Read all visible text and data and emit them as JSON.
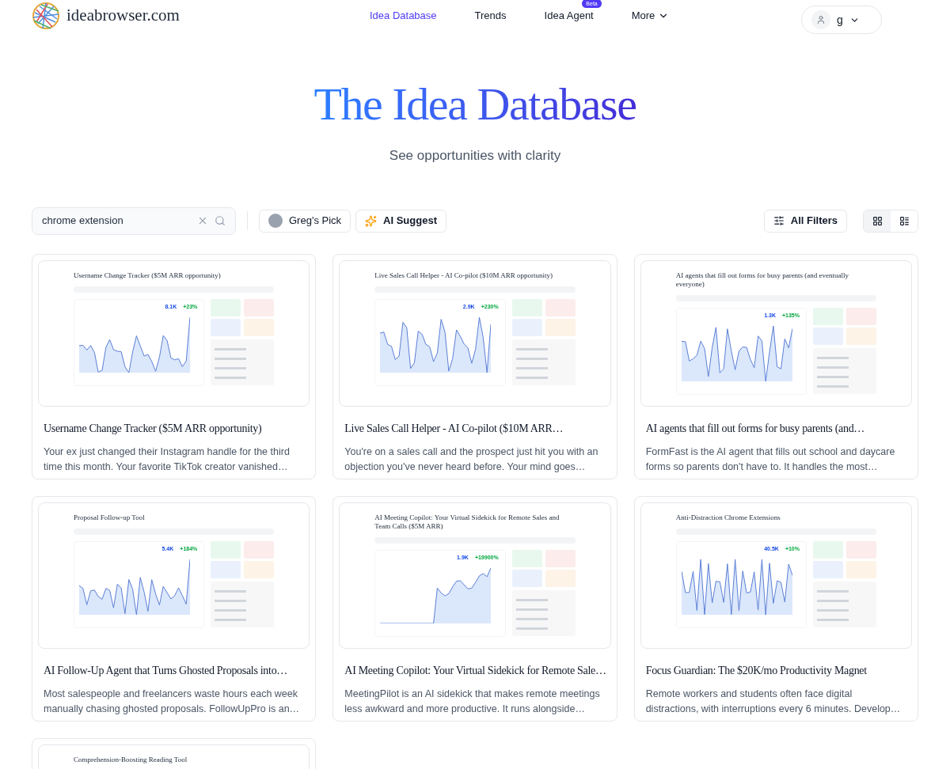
{
  "brand": {
    "name": "ideabrowser.com"
  },
  "nav": [
    {
      "label": "Idea Database",
      "selected": true
    },
    {
      "label": "Trends",
      "selected": false
    },
    {
      "label": "Idea Agent",
      "selected": false,
      "badge": "Beta"
    },
    {
      "label": "More",
      "selected": false,
      "dropdown": true
    }
  ],
  "account": {
    "initial": "g"
  },
  "hero": {
    "title": "The Idea Database",
    "subtitle": "See opportunities with clarity"
  },
  "search": {
    "value": "chrome extension"
  },
  "quick_filters": [
    {
      "kind": "avatar",
      "label": "Greg's Pick"
    },
    {
      "kind": "sparkle",
      "label": "AI Suggest"
    }
  ],
  "filters_button": "All Filters",
  "views": [
    {
      "kind": "grid",
      "selected": true
    },
    {
      "kind": "list",
      "selected": false
    }
  ],
  "cards": [
    {
      "preview_title": "Username Change Tracker ($5M ARR opportunity)",
      "volume": "8.1K",
      "growth": "+23%",
      "title": "Username Change Tracker ($5M ARR opportunity)",
      "description": "Your ex just changed their Instagram handle for the third time this month. Your favorite TikTok creator vanished…"
    },
    {
      "preview_title": "Live Sales Call Helper - AI Co-pilot ($10M ARR opportunity)",
      "volume": "2.9K",
      "growth": "+230%",
      "title": "Live Sales Call Helper - AI Co-pilot ($10M ARR…",
      "description": "You're on a sales call and the prospect just hit you with an objection you've never heard before. Your mind goes…"
    },
    {
      "preview_title": "AI agents that fill out forms for busy parents (and eventually everyone)",
      "volume": "1.3K",
      "growth": "+135%",
      "title": "AI agents that fill out forms for busy parents (and…",
      "description": "FormFast is the AI agent that fills out school and daycare forms so parents don't have to. It handles the most…"
    },
    {
      "preview_title": "Proposal Follow-up Tool",
      "volume": "5.4K",
      "growth": "+184%",
      "title": "AI Follow-Up Agent that Turns Ghosted Proposals into…",
      "description": "Most salespeople and freelancers waste hours each week manually chasing ghosted proposals. FollowUpPro is an…"
    },
    {
      "preview_title": "AI Meeting Copilot: Your Virtual Sidekick for Remote Sales and Team Calls ($5M ARR)",
      "volume": "1.9K",
      "growth": "+19900%",
      "title": "AI Meeting Copilot: Your Virtual Sidekick for Remote Sale…",
      "description": "MeetingPilot is an AI sidekick that makes remote meetings less awkward and more productive. It runs alongside…"
    },
    {
      "preview_title": "Anti-Distraction Chrome Extensions",
      "volume": "40.5K",
      "growth": "+10%",
      "title": "Focus Guardian: The $20K/mo Productivity Magnet",
      "description": "Remote workers and students often face digital distractions, with interruptions every 6 minutes. Develop…"
    },
    {
      "preview_title": "Comprehension-Boosting Reading Tool"
    }
  ]
}
